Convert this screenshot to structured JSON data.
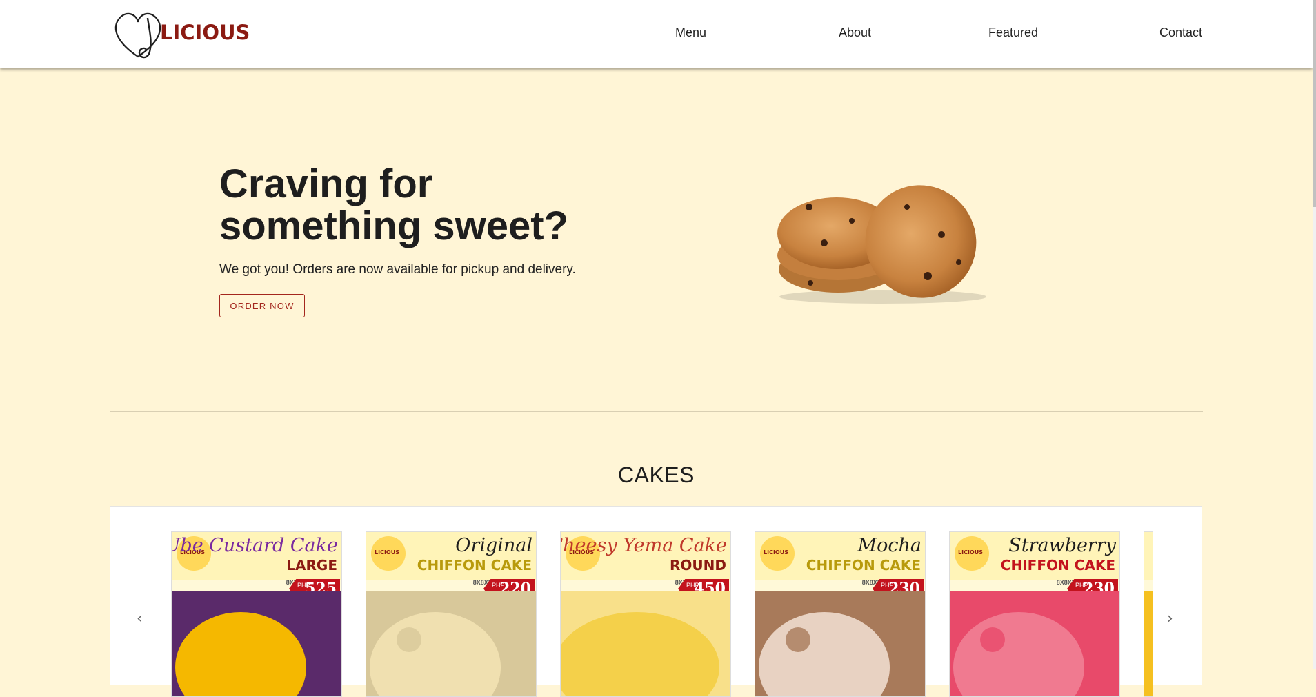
{
  "header": {
    "logo_text": "LICIOUS",
    "nav": [
      "Menu",
      "About",
      "Featured",
      "Contact"
    ]
  },
  "hero": {
    "title": "Craving for\nsomething sweet?",
    "subtitle": "We got you! Orders are now available for pickup and delivery.",
    "button_label": "ORDER NOW"
  },
  "section": {
    "title": "CAKES"
  },
  "carousel": {
    "prev_icon": "chevron-left-icon",
    "next_icon": "chevron-right-icon",
    "cards": [
      {
        "badge": "LICIOUS",
        "script": "Ube Custard Cake",
        "sub": "LARGE",
        "size": "8X3\"",
        "price_prefix": "PHP",
        "price": "525",
        "script_color": "#7a2aa0",
        "sub_color": "#8b1a12"
      },
      {
        "badge": "LICIOUS",
        "script": "Original",
        "sub": "CHIFFON CAKE",
        "size": "8X8X3\"",
        "price_prefix": "PHP",
        "price": "220",
        "script_color": "#1e1e1e",
        "sub_color": "#b89a0c"
      },
      {
        "badge": "LICIOUS",
        "script": "Cheesy Yema Cake",
        "sub": "ROUND",
        "size": "8X3\"",
        "price_prefix": "PHP",
        "price": "450",
        "script_color": "#c0392b",
        "sub_color": "#8b1a12"
      },
      {
        "badge": "LICIOUS",
        "script": "Mocha",
        "sub": "CHIFFON CAKE",
        "size": "8X8X3\"",
        "price_prefix": "PHP",
        "price": "230",
        "script_color": "#1e1e1e",
        "sub_color": "#b89a0c"
      },
      {
        "badge": "LICIOUS",
        "script": "Strawberry",
        "sub": "CHIFFON CAKE",
        "size": "8X8X3\"",
        "price_prefix": "PHP",
        "price": "230",
        "script_color": "#1e1e1e",
        "sub_color": "#c3131d"
      }
    ]
  }
}
